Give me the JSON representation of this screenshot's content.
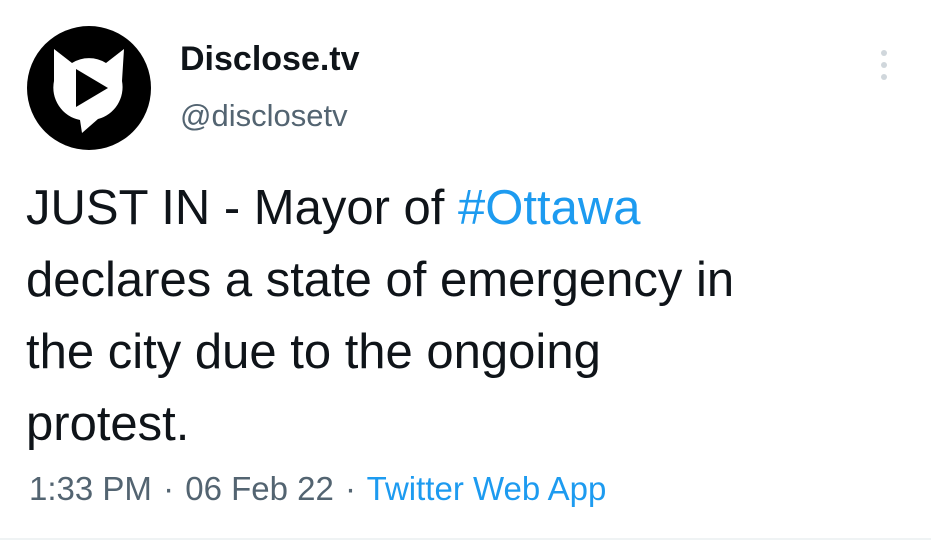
{
  "author": {
    "display_name": "Disclose.tv",
    "handle": "@disclosetv",
    "avatar_icon": "play-button-cat-logo-icon"
  },
  "tweet": {
    "text_before_hashtag": "JUST IN - Mayor of ",
    "hashtag": "#Ottawa",
    "line2": "declares a state of emergency in",
    "line3": "the city due to the ongoing",
    "line4": "protest."
  },
  "meta": {
    "time": "1:33 PM",
    "separator": "·",
    "date": "06 Feb 22",
    "source": "Twitter Web App"
  },
  "menu_icon": "more-vertical-icon",
  "colors": {
    "text": "#0f1419",
    "secondary": "#536471",
    "link": "#1d9bf0",
    "background": "#ffffff"
  }
}
